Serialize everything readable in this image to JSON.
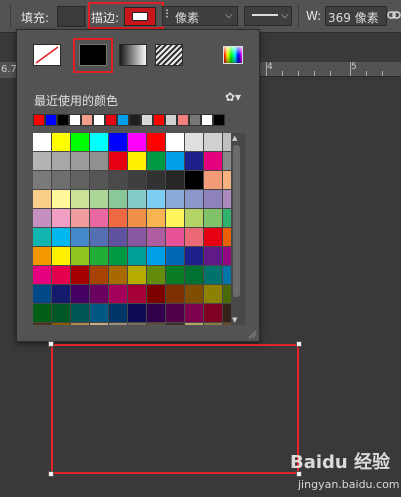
{
  "toolbar": {
    "fill_label": "填充:",
    "stroke_label": "描边:",
    "unit_value": "像素",
    "width_label": "W:",
    "width_value": "369 像素",
    "left_value": "6.7"
  },
  "ruler": {
    "mark": "4",
    "mark2": "5"
  },
  "panel": {
    "recent_label": "最近使用的颜色",
    "stroke_types": [
      "none",
      "solid-color",
      "gradient",
      "pattern"
    ],
    "selected_type": "solid-color",
    "recent_colors": [
      "#ff0000",
      "#0000ff",
      "#000000",
      "#ffffff",
      "#f29f8a",
      "#ffffff",
      "#e60012",
      "#00a0e9",
      "#1f1f1f",
      "#d9d9d9",
      "#ff0000",
      "#d0d0d0",
      "#f08080",
      "#777777",
      "#ffffff",
      "#000000"
    ],
    "swatches": [
      "#ffffff",
      "#ffff00",
      "#00ff00",
      "#00ffff",
      "#0000ff",
      "#ff00ff",
      "#ff0000",
      "#ffffff",
      "#e0e0e0",
      "#d0d0d0",
      "#c0c0c0",
      "#b4b4b4",
      "#a8a8a8",
      "#9c9c9c",
      "#909090",
      "#e60012",
      "#fff100",
      "#009944",
      "#00a0e9",
      "#1d2088",
      "#e4007f",
      "#888888",
      "#7a7a7a",
      "#6e6e6e",
      "#626262",
      "#565656",
      "#4a4a4a",
      "#3e3e3e",
      "#323232",
      "#262626",
      "#000000",
      "#f29b76",
      "#f6b37f",
      "#facd89",
      "#fff799",
      "#cce198",
      "#acd598",
      "#89c997",
      "#84ccc9",
      "#7ecef4",
      "#88abda",
      "#8c97cb",
      "#8f82bc",
      "#aa89bd",
      "#c490bf",
      "#f19ec2",
      "#f19d9d",
      "#ea68a2",
      "#ec6941",
      "#f19149",
      "#f8b551",
      "#fff45c",
      "#b3d465",
      "#80c269",
      "#32b16c",
      "#13b5b1",
      "#00b7ee",
      "#448aca",
      "#556fb5",
      "#5f52a0",
      "#8957a1",
      "#ae5da1",
      "#e85298",
      "#eb6877",
      "#e60012",
      "#eb6100",
      "#f39800",
      "#fff100",
      "#8fc31f",
      "#22ac38",
      "#009944",
      "#009e96",
      "#00a0e9",
      "#0068b7",
      "#1d2088",
      "#601986",
      "#920783",
      "#e4007f",
      "#e5004f",
      "#a40000",
      "#a84200",
      "#a86900",
      "#b7aa00",
      "#638c0b",
      "#097c25",
      "#007130",
      "#00736d",
      "#0075a9",
      "#004986",
      "#141a6c",
      "#440062",
      "#6a005f",
      "#a4005b",
      "#a40035",
      "#7d0000",
      "#7e3000",
      "#804e00",
      "#8c8100",
      "#4a6a09",
      "#005e15",
      "#005826",
      "#005652",
      "#005982",
      "#003567",
      "#0c0b53",
      "#32004b",
      "#51004a",
      "#7e004f",
      "#7e0023",
      "#332219",
      "#4c3214",
      "#8a5a00",
      "#b28850",
      "#c9ab84",
      "#9a8f7c",
      "#7a6f5c",
      "#5b4c3c",
      "#3e3128",
      "#b8a56b",
      "#8a7a45",
      "#6b4a2a",
      "#4e2a14",
      "#3c1e0c",
      "#a06040",
      "#c08060",
      "#d0a080",
      "#e0c0a0",
      "#806040",
      "#604020",
      "#402010",
      "#201000",
      "#100800"
    ]
  },
  "colors": {
    "accent_red": "#e0252a",
    "panel_bg": "#535353",
    "canvas_bg": "#3a3838"
  },
  "watermark": {
    "brand": "Baidu 经验",
    "url": "jingyan.baidu.com"
  }
}
